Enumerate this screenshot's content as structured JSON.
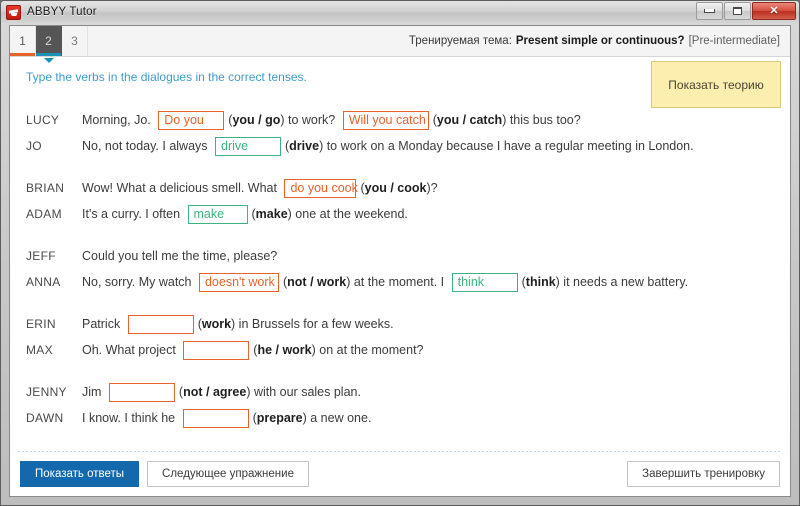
{
  "window": {
    "title": "ABBYY Tutor",
    "icon": "graduation-cap-icon",
    "controls": {
      "minimize": "–",
      "maximize": "▢",
      "close": "✕"
    }
  },
  "tabs": [
    {
      "label": "1",
      "state": "completed"
    },
    {
      "label": "2",
      "state": "active"
    },
    {
      "label": "3",
      "state": "pending"
    }
  ],
  "topic": {
    "label": "Тренируемая тема:",
    "name": "Present simple or continuous?",
    "level": "[Pre-intermediate]"
  },
  "instruction": "Type the verbs in the dialogues in the correct tenses.",
  "theory_button": "Показать теорию",
  "exercise": {
    "blocks": [
      {
        "lines": [
          {
            "speaker": "LUCY",
            "parts": [
              {
                "type": "text",
                "text": "Morning, Jo. "
              },
              {
                "type": "blank",
                "value": "Do you",
                "state": "wrong",
                "width": "w66"
              },
              {
                "type": "hint",
                "text": "(",
                "bold": "you / go",
                "after": ") to work? "
              },
              {
                "type": "blank",
                "value": "Will you catch",
                "state": "wrong",
                "width": "w86"
              },
              {
                "type": "hint",
                "text": "(",
                "bold": "you / catch",
                "after": ") this bus too?"
              }
            ]
          },
          {
            "speaker": "JO",
            "parts": [
              {
                "type": "text",
                "text": "No, not today. I always "
              },
              {
                "type": "blank",
                "value": "drive",
                "state": "right",
                "width": "w66"
              },
              {
                "type": "hint",
                "text": "(",
                "bold": "drive",
                "after": ") to work on a Monday because I have a regular meeting in London."
              }
            ]
          }
        ]
      },
      {
        "lines": [
          {
            "speaker": "BRIAN",
            "parts": [
              {
                "type": "text",
                "text": "Wow! What a delicious smell. What "
              },
              {
                "type": "blank",
                "value": "do you cook",
                "state": "wrong",
                "width": "w72"
              },
              {
                "type": "hint",
                "text": "(",
                "bold": "you / cook",
                "after": ")?"
              }
            ]
          },
          {
            "speaker": "ADAM",
            "parts": [
              {
                "type": "text",
                "text": "It's a curry. I often "
              },
              {
                "type": "blank",
                "value": "make",
                "state": "right",
                "width": "w60"
              },
              {
                "type": "hint",
                "text": "(",
                "bold": "make",
                "after": ") one at the weekend."
              }
            ]
          }
        ]
      },
      {
        "lines": [
          {
            "speaker": "JEFF",
            "parts": [
              {
                "type": "text",
                "text": "Could you tell me the time, please?"
              }
            ]
          },
          {
            "speaker": "ANNA",
            "parts": [
              {
                "type": "text",
                "text": "No, sorry. My watch "
              },
              {
                "type": "blank",
                "value": "doesn't work",
                "state": "wrong",
                "width": "w80"
              },
              {
                "type": "hint",
                "text": "(",
                "bold": "not / work",
                "after": ") at the moment. I "
              },
              {
                "type": "blank",
                "value": "think",
                "state": "right",
                "width": "w66"
              },
              {
                "type": "hint",
                "text": "(",
                "bold": "think",
                "after": ") it needs a new battery."
              }
            ]
          }
        ]
      },
      {
        "lines": [
          {
            "speaker": "ERIN",
            "parts": [
              {
                "type": "text",
                "text": "Patrick "
              },
              {
                "type": "blank",
                "value": "",
                "state": "empty",
                "width": "w66"
              },
              {
                "type": "hint",
                "text": "(",
                "bold": "work",
                "after": ") in Brussels for a few weeks."
              }
            ]
          },
          {
            "speaker": "MAX",
            "parts": [
              {
                "type": "text",
                "text": "Oh. What project "
              },
              {
                "type": "blank",
                "value": "",
                "state": "empty",
                "width": "w66"
              },
              {
                "type": "hint",
                "text": "(",
                "bold": "he / work",
                "after": ") on at the moment?"
              }
            ]
          }
        ]
      },
      {
        "lines": [
          {
            "speaker": "JENNY",
            "parts": [
              {
                "type": "text",
                "text": "Jim "
              },
              {
                "type": "blank",
                "value": "",
                "state": "empty",
                "width": "w66"
              },
              {
                "type": "hint",
                "text": "(",
                "bold": "not / agree",
                "after": ") with our sales plan."
              }
            ]
          },
          {
            "speaker": "DAWN",
            "parts": [
              {
                "type": "text",
                "text": "I know. I think he "
              },
              {
                "type": "blank",
                "value": "",
                "state": "empty",
                "width": "w66"
              },
              {
                "type": "hint",
                "text": "(",
                "bold": "prepare",
                "after": ") a new one."
              }
            ]
          }
        ]
      }
    ]
  },
  "footer": {
    "show_answers": "Показать ответы",
    "next_exercise": "Следующее упражнение",
    "finish": "Завершить тренировку"
  },
  "colors": {
    "wrong": "#e8622a",
    "correct": "#3db380",
    "accent_blue": "#1369ab",
    "instruction_blue": "#3e9ccc",
    "theory_yellow": "#fbeeae",
    "tab_active_bg": "#555555",
    "tab_active_bar": "#1993b5"
  }
}
